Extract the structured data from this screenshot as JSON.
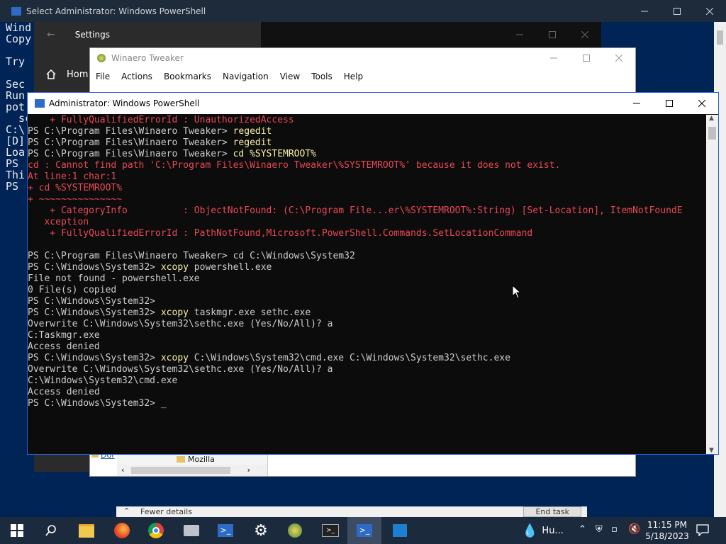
{
  "background_ps": {
    "title": "Select Administrator: Windows PowerShell",
    "lines": [
      "Wind",
      "Copy",
      "",
      "Try",
      "",
      "Sec",
      "Run",
      "pot",
      "  sc",
      "C:\\",
      "[D]",
      "Loa",
      "PS",
      "Thi",
      "PS"
    ]
  },
  "settings": {
    "title": "Settings",
    "home_label": "Hom"
  },
  "winaero": {
    "title": "Winaero Tweaker",
    "menu": [
      "File",
      "Actions",
      "Bookmarks",
      "Navigation",
      "View",
      "Tools",
      "Help"
    ],
    "tree_item": "Mozilla",
    "link_fragment": "Dor"
  },
  "task_manager": {
    "fewer_details": "Fewer details",
    "end_task": "End task"
  },
  "powershell": {
    "title": "Administrator: Windows PowerShell",
    "lines": [
      [
        {
          "t": "    + FullyQualifiedErrorId : UnauthorizedAccess",
          "c": "r"
        }
      ],
      [
        {
          "t": "PS C:\\Program Files\\Winaero Tweaker> ",
          "c": "w"
        },
        {
          "t": "regedit",
          "c": "y"
        }
      ],
      [
        {
          "t": "PS C:\\Program Files\\Winaero Tweaker> ",
          "c": "w"
        },
        {
          "t": "regedit",
          "c": "y"
        }
      ],
      [
        {
          "t": "PS C:\\Program Files\\Winaero Tweaker> ",
          "c": "w"
        },
        {
          "t": "cd %SYSTEMROOT%",
          "c": "y"
        }
      ],
      [
        {
          "t": "cd : Cannot find path 'C:\\Program Files\\Winaero Tweaker\\%SYSTEMROOT%' because it does not exist.",
          "c": "r"
        }
      ],
      [
        {
          "t": "At line:1 char:1",
          "c": "r"
        }
      ],
      [
        {
          "t": "+ cd %SYSTEMROOT%",
          "c": "r"
        }
      ],
      [
        {
          "t": "+ ~~~~~~~~~~~~~~~",
          "c": "r"
        }
      ],
      [
        {
          "t": "    + CategoryInfo          : ObjectNotFound: (C:\\Program File...er\\%SYSTEMROOT%:String) [Set-Location], ItemNotFoundE",
          "c": "r"
        }
      ],
      [
        {
          "t": "   xception",
          "c": "r"
        }
      ],
      [
        {
          "t": "    + FullyQualifiedErrorId : PathNotFound,Microsoft.PowerShell.Commands.SetLocationCommand",
          "c": "r"
        }
      ],
      [
        {
          "t": "",
          "c": "w"
        }
      ],
      [
        {
          "t": "PS C:\\Program Files\\Winaero Tweaker> ",
          "c": "w"
        },
        {
          "t": "cd C:\\Windows\\System32",
          "c": "w"
        }
      ],
      [
        {
          "t": "PS C:\\Windows\\System32> ",
          "c": "w"
        },
        {
          "t": "xcopy",
          "c": "y"
        },
        {
          "t": " powershell.exe",
          "c": "w"
        }
      ],
      [
        {
          "t": "File not found - powershell.exe",
          "c": "w"
        }
      ],
      [
        {
          "t": "0 File(s) copied",
          "c": "w"
        }
      ],
      [
        {
          "t": "PS C:\\Windows\\System32>",
          "c": "w"
        }
      ],
      [
        {
          "t": "PS C:\\Windows\\System32> ",
          "c": "w"
        },
        {
          "t": "xcopy",
          "c": "y"
        },
        {
          "t": " taskmgr.exe sethc.exe",
          "c": "w"
        }
      ],
      [
        {
          "t": "Overwrite C:\\Windows\\System32\\sethc.exe (Yes/No/All)? a",
          "c": "w"
        }
      ],
      [
        {
          "t": "C:Taskmgr.exe",
          "c": "w"
        }
      ],
      [
        {
          "t": "Access denied",
          "c": "w"
        }
      ],
      [
        {
          "t": "PS C:\\Windows\\System32> ",
          "c": "w"
        },
        {
          "t": "xcopy",
          "c": "y"
        },
        {
          "t": " C:\\Windows\\System32\\cmd.exe C:\\Windows\\System32\\sethc.exe",
          "c": "w"
        }
      ],
      [
        {
          "t": "Overwrite C:\\Windows\\System32\\sethc.exe (Yes/No/All)? a",
          "c": "w"
        }
      ],
      [
        {
          "t": "C:\\Windows\\System32\\cmd.exe",
          "c": "w"
        }
      ],
      [
        {
          "t": "Access denied",
          "c": "w"
        }
      ],
      [
        {
          "t": "PS C:\\Windows\\System32> ",
          "c": "w"
        },
        {
          "t": "_",
          "c": "w"
        }
      ]
    ]
  },
  "taskbar": {
    "weather": "Hu...",
    "time": "11:15 PM",
    "date": "5/18/2023",
    "icons": [
      "windows-start-icon",
      "search-icon",
      "file-explorer-icon",
      "firefox-icon",
      "chrome-icon",
      "drive-icon",
      "powershell-icon",
      "settings-icon",
      "winaero-icon",
      "terminal-icon",
      "powershell-active-icon",
      "task-manager-icon"
    ]
  }
}
